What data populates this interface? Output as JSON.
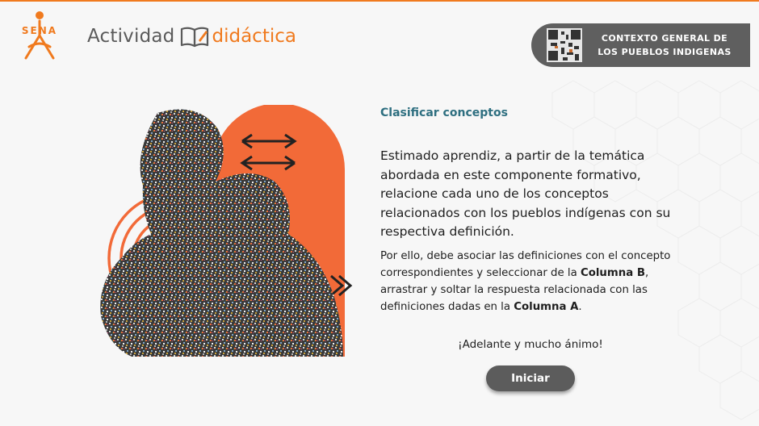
{
  "header": {
    "logo_text": "SENA",
    "brand_part1": "Actividad",
    "brand_part2": "didáctica",
    "context_title": "CONTEXTO GENERAL DE LOS PUEBLOS INDIGENAS"
  },
  "content": {
    "section_title": "Clasificar conceptos",
    "intro": "Estimado aprendiz, a partir de la temática abordada en este componente formativo, relacione cada uno de los conceptos relacionados con los pueblos indígenas con su respectiva definición.",
    "instructions": {
      "part1": "Por ello, debe asociar las definiciones con el concepto correspondientes y seleccionar de la ",
      "columna_b": "Columna B",
      "part2": ", arrastrar y soltar la respuesta relacionada con las definiciones dadas en la ",
      "columna_a": "Columna A",
      "part3": "."
    },
    "encouragement": "¡Adelante y mucho ánimo!",
    "start_button": "Iniciar"
  },
  "colors": {
    "accent_orange": "#f07a1e",
    "illustration_orange": "#f26a38",
    "title_teal": "#2e6f80",
    "pill_gray": "#5f5f5f",
    "button_gray": "#5c5c5c"
  }
}
